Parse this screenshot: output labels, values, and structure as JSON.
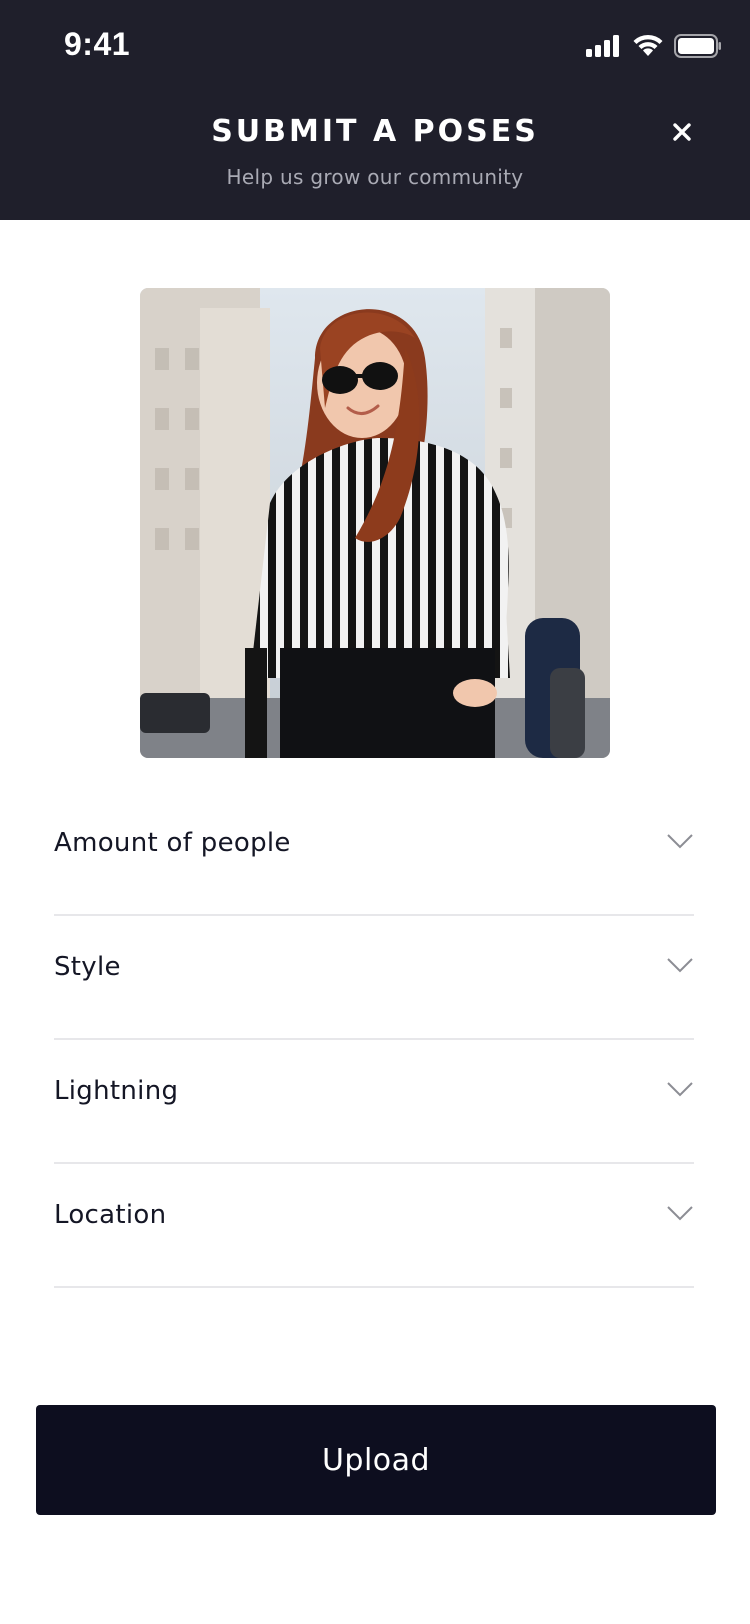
{
  "status_bar": {
    "time": "9:41",
    "icons": [
      "signal-icon",
      "wifi-icon",
      "battery-icon"
    ]
  },
  "header": {
    "title": "SUBMIT A POSES",
    "subtitle": "Help us grow our community",
    "close_icon": "close-icon"
  },
  "photo": {
    "description_icon": "pose-photo"
  },
  "form": {
    "rows": [
      {
        "label": "Amount of people",
        "icon": "chevron-down-icon"
      },
      {
        "label": "Style",
        "icon": "chevron-down-icon"
      },
      {
        "label": "Lightning",
        "icon": "chevron-down-icon"
      },
      {
        "label": "Location",
        "icon": "chevron-down-icon"
      }
    ]
  },
  "upload": {
    "label": "Upload"
  },
  "colors": {
    "header_bg": "#1f1f2b",
    "button_bg": "#0d0e1f",
    "divider": "#e7e7ea",
    "text": "#141625",
    "subtitle": "#a9aab4"
  }
}
